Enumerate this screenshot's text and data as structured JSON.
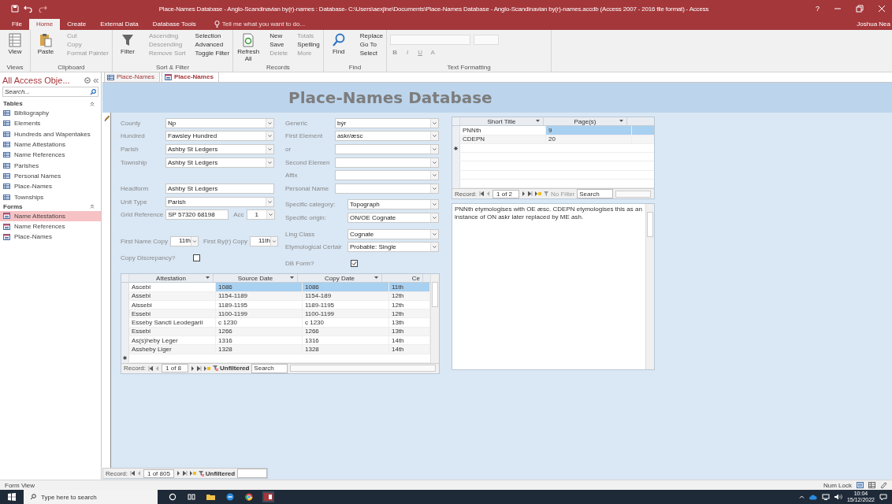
{
  "window": {
    "title": "Place-Names Database - Anglo-Scandinavian by(r)-names : Database- C:\\Users\\aexjlne\\Documents\\Place-Names Database - Anglo-Scandinavian by(r)-names.accdb (Access 2007 - 2016 file format) - Access",
    "help": "?",
    "user": "Joshua Nea"
  },
  "ribbon_tabs": [
    {
      "label": "File",
      "selected": false
    },
    {
      "label": "Home",
      "selected": true
    },
    {
      "label": "Create",
      "selected": false
    },
    {
      "label": "External Data",
      "selected": false
    },
    {
      "label": "Database Tools",
      "selected": false
    }
  ],
  "tell_me": {
    "placeholder": "Tell me what you want to do..."
  },
  "ribbon_groups": [
    {
      "label": "Views",
      "large": [
        {
          "label": "View",
          "kind": "view"
        }
      ]
    },
    {
      "label": "Clipboard",
      "large": [
        {
          "label": "Paste",
          "kind": "paste"
        }
      ],
      "small": [
        {
          "label": "Cut",
          "disabled": true
        },
        {
          "label": "Copy",
          "disabled": true
        },
        {
          "label": "Format Painter",
          "disabled": true
        }
      ]
    },
    {
      "label": "Sort & Filter",
      "large": [
        {
          "label": "Filter",
          "kind": "filter"
        }
      ],
      "small": [
        {
          "label": "Ascending",
          "disabled": true
        },
        {
          "label": "Descending",
          "disabled": true
        },
        {
          "label": "Remove Sort",
          "disabled": true
        },
        {
          "label": "Selection",
          "disabled": false
        },
        {
          "label": "Advanced",
          "disabled": false
        },
        {
          "label": "Toggle Filter",
          "disabled": false
        }
      ]
    },
    {
      "label": "Records",
      "large": [
        {
          "label": "Refresh All",
          "kind": "refresh"
        }
      ],
      "small": [
        {
          "label": "New",
          "disabled": false
        },
        {
          "label": "Save",
          "disabled": false
        },
        {
          "label": "Delete",
          "disabled": true
        },
        {
          "label": "Totals",
          "disabled": true
        },
        {
          "label": "Spelling",
          "disabled": false
        },
        {
          "label": "More",
          "disabled": true
        }
      ]
    },
    {
      "label": "Find",
      "large": [
        {
          "label": "Find",
          "kind": "find"
        }
      ],
      "small": [
        {
          "label": "Replace",
          "disabled": false
        },
        {
          "label": "Go To",
          "disabled": false
        },
        {
          "label": "Select",
          "disabled": false
        }
      ]
    }
  ],
  "text_formatting": {
    "label": "Text Formatting",
    "buttons": [
      {
        "label": "B",
        "disabled": true
      },
      {
        "label": "I",
        "disabled": true
      },
      {
        "label": "U",
        "disabled": true
      },
      {
        "label": "A",
        "disabled": true
      }
    ]
  },
  "nav": {
    "title": "All Access Obje...",
    "search": {
      "placeholder": "Search..."
    },
    "sections": [
      {
        "title": "Tables",
        "items": [
          {
            "label": "Bibliography",
            "kind": "table",
            "selected": false
          },
          {
            "label": "Elements",
            "kind": "table",
            "selected": false
          },
          {
            "label": "Hundreds and Wapentakes",
            "kind": "table",
            "selected": false
          },
          {
            "label": "Name Attestations",
            "kind": "table",
            "selected": false
          },
          {
            "label": "Name References",
            "kind": "table",
            "selected": false
          },
          {
            "label": "Parishes",
            "kind": "table",
            "selected": false
          },
          {
            "label": "Personal Names",
            "kind": "table",
            "selected": false
          },
          {
            "label": "Place-Names",
            "kind": "table",
            "selected": false
          },
          {
            "label": "Townships",
            "kind": "table",
            "selected": false
          }
        ]
      },
      {
        "title": "Forms",
        "items": [
          {
            "label": "Name Attestations",
            "kind": "form",
            "selected": true
          },
          {
            "label": "Name References",
            "kind": "form",
            "selected": false
          },
          {
            "label": "Place-Names",
            "kind": "form",
            "selected": false
          }
        ]
      }
    ]
  },
  "doc_tabs": [
    {
      "label": "Place-Names",
      "kind": "table",
      "selected": false
    },
    {
      "label": "Place-Names",
      "kind": "form",
      "selected": true
    }
  ],
  "form": {
    "title": "Place-Names Database",
    "left_blocks": [
      {
        "rows": [
          [
            {
              "label": "County",
              "value": "Np",
              "kind": "combo"
            }
          ],
          [
            {
              "label": "Hundred",
              "value": "Fawsley Hundred",
              "kind": "combo"
            }
          ],
          [
            {
              "label": "Parish",
              "value": "Ashby St Ledgers",
              "kind": "combo"
            }
          ],
          [
            {
              "label": "Township",
              "value": "Ashby St Ledgers",
              "kind": "combo"
            }
          ]
        ]
      },
      {
        "rows": [
          [
            {
              "label": "Headform",
              "value": "Ashby St Ledgers",
              "kind": "text"
            }
          ],
          [
            {
              "label": "Unit Type",
              "value": "Parish",
              "kind": "combo"
            }
          ],
          [
            {
              "label": "Grid Reference",
              "value": "SP 57320 68198",
              "kind": "short_text"
            },
            {
              "label": "Acc",
              "value": "1",
              "kind": "small_combo"
            }
          ]
        ]
      },
      {
        "rows": [
          [
            {
              "label": "First Name Copy",
              "value": "11th",
              "kind": "small_combo"
            },
            {
              "label": "First By(r) Copy",
              "value": "11th",
              "kind": "small_combo"
            }
          ]
        ]
      },
      {
        "rows": [
          [
            {
              "label": "Copy Discrepancy?",
              "kind": "checkbox",
              "checked": false
            }
          ]
        ]
      }
    ],
    "right_blocks": [
      {
        "rows": [
          [
            {
              "label": "Generic",
              "value": "býr",
              "kind": "combo"
            }
          ],
          [
            {
              "label": "First Element",
              "value": "askr/æsc",
              "kind": "combo"
            }
          ],
          [
            {
              "label": "or",
              "kind": "combo"
            }
          ],
          [
            {
              "label": "Second Elemen",
              "kind": "combo"
            }
          ],
          [
            {
              "label": "Affix",
              "kind": "combo"
            }
          ],
          [
            {
              "label": "Personal Name",
              "kind": "combo"
            }
          ]
        ]
      },
      {
        "rows": [
          [
            {
              "label": "Specific category:",
              "value": "Topograph",
              "kind": "combo"
            }
          ],
          [
            {
              "label": "Specific origin:",
              "value": "ON/OE Cognate",
              "kind": "combo"
            }
          ]
        ]
      },
      {
        "rows": [
          [
            {
              "label": "Ling Class",
              "value": "Cognate",
              "kind": "combo"
            }
          ],
          [
            {
              "label": "Etymological Certair",
              "value": "Probable: Single",
              "kind": "combo"
            }
          ]
        ]
      },
      {
        "rows": [
          [
            {
              "label": "DB Form?",
              "kind": "checkbox",
              "checked": true
            }
          ]
        ]
      }
    ],
    "attestations": {
      "columns": [
        "Attestation",
        "Source Date",
        "Copy Date",
        "Ce"
      ],
      "rows": [
        {
          "cells": [
            "Ascebi",
            "1086",
            "1086",
            "11th"
          ],
          "selected": true
        },
        {
          "cells": [
            "Assebi",
            "1154-1189",
            "1154-189",
            "12th"
          ],
          "selected": false
        },
        {
          "cells": [
            "Aissebi",
            "1189-1195",
            "1189-1195",
            "12th"
          ],
          "selected": false
        },
        {
          "cells": [
            "Essebi",
            "1100-1199",
            "1100-1199",
            "12th"
          ],
          "selected": false
        },
        {
          "cells": [
            "Esseby Sancti Leodegarii",
            "c 1230",
            "c 1230",
            "13th"
          ],
          "selected": false
        },
        {
          "cells": [
            "Essebi",
            "1266",
            "1266",
            "13th"
          ],
          "selected": false
        },
        {
          "cells": [
            "As(s)heby Leger",
            "1316",
            "1316",
            "14th"
          ],
          "selected": false
        },
        {
          "cells": [
            "Assheby Liger",
            "1328",
            "1328",
            "14th"
          ],
          "selected": false
        }
      ],
      "nav": {
        "label": "Record:",
        "position": "1 of 8",
        "filter": "Unfiltered",
        "filter_active": true,
        "search": "Search"
      }
    },
    "references": {
      "columns": [
        "Short Title",
        "Page(s)"
      ],
      "rows": [
        {
          "cells": [
            "PNNth",
            "9"
          ],
          "selected": true
        },
        {
          "cells": [
            "CDEPN",
            "20"
          ],
          "selected": false
        }
      ],
      "nav": {
        "label": "Record:",
        "position": "1 of 2",
        "filter": "No Filter",
        "filter_active": false,
        "search": "Search"
      }
    },
    "notes": "PNNth etymologises with OE æsc. CDEPN etymologises this as an instance of ON askr later replaced by ME ash.",
    "record_nav": {
      "label": "Record:",
      "position": "1 of 805",
      "filter": "Unfiltered"
    }
  },
  "status_bar": {
    "left": "Form View",
    "right": "Num Lock"
  },
  "taskbar": {
    "search": {
      "placeholder": "Type here to search"
    },
    "time": "10:04",
    "date": "15/12/2022"
  }
}
